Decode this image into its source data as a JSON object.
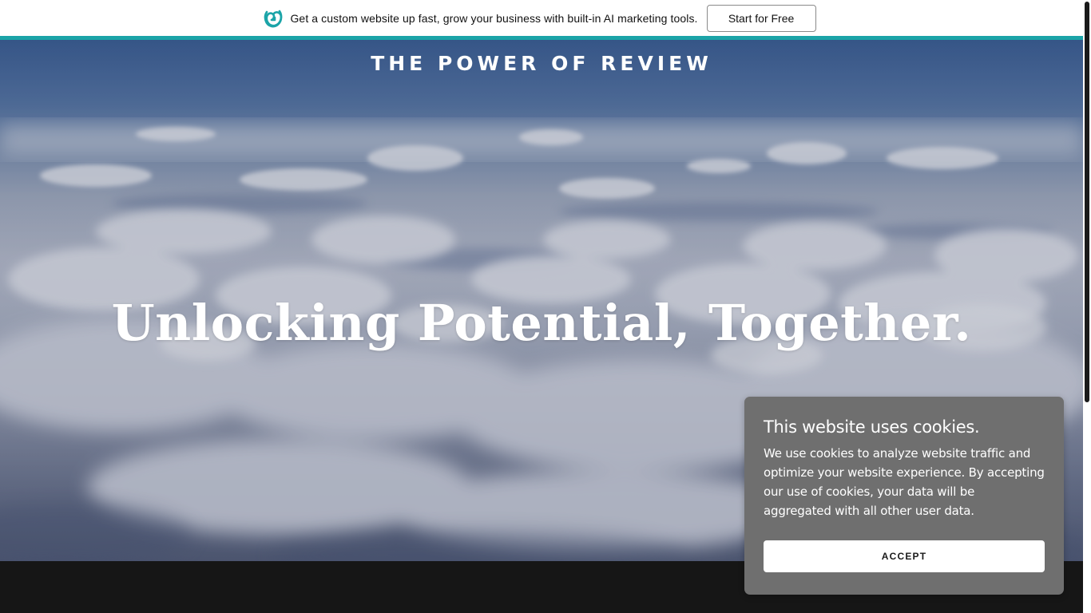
{
  "promo_bar": {
    "logo_icon": "godaddy-logo-icon",
    "text": "Get a custom website up fast, grow your business with built-in AI marketing tools.",
    "button_label": "Start for Free",
    "accent_color": "#1ba4a8"
  },
  "hero": {
    "site_title": "THE POWER OF REVIEW",
    "headline": "Unlocking Potential, Together.",
    "background": "clouds-aerial-photo"
  },
  "cookie_dialog": {
    "title": "This website uses cookies.",
    "body": "We use cookies to analyze website traffic and optimize your website experience. By accepting our use of cookies, your data will be aggregated with all other user data.",
    "accept_label": "ACCEPT"
  },
  "colors": {
    "dialog_background": "#6f6f6f",
    "footer_background": "#161616"
  }
}
